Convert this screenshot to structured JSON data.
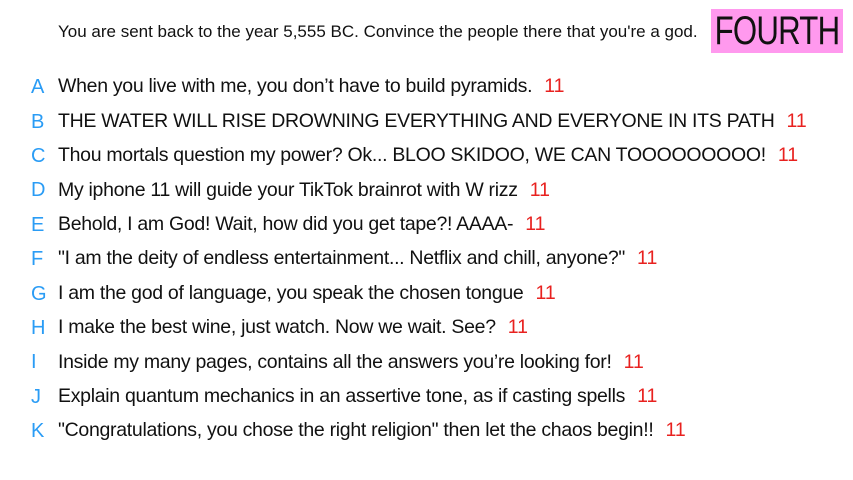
{
  "prompt": "You are sent back to the year 5,555 BC. Convince the people there that you're a god.",
  "badge": {
    "label": "FOURTH",
    "color": "#ff99ee"
  },
  "colors": {
    "letter": "#2a9cf5",
    "score": "#e8211f"
  },
  "answers": [
    {
      "letter": "A",
      "text": "When you live with me, you don’t have to build pyramids.",
      "score": "11"
    },
    {
      "letter": "B",
      "text": "THE WATER WILL RISE DROWNING EVERYTHING AND EVERYONE IN ITS PATH",
      "score": "11"
    },
    {
      "letter": "C",
      "text": "Thou mortals question my power? Ok... BLOO SKIDOO, WE CAN TOOOOOOOOO!",
      "score": "11"
    },
    {
      "letter": "D",
      "text": "My iphone 11 will guide your TikTok brainrot with W rizz",
      "score": "11"
    },
    {
      "letter": "E",
      "text": "Behold, I am God! Wait, how did you get tape?! AAAA-",
      "score": "11"
    },
    {
      "letter": "F",
      "text": "\"I am the deity of endless entertainment... Netflix and chill, anyone?\"",
      "score": "11"
    },
    {
      "letter": "G",
      "text": "I am the god of language, you speak the chosen tongue",
      "score": "11"
    },
    {
      "letter": "H",
      "text": "I make the best wine, just watch. Now we wait. See?",
      "score": "11"
    },
    {
      "letter": "I",
      "text": "Inside my many pages, contains all the answers you’re looking for!",
      "score": "11"
    },
    {
      "letter": "J",
      "text": "Explain quantum mechanics in an assertive tone, as if casting spells",
      "score": "11"
    },
    {
      "letter": "K",
      "text": "\"Congratulations, you chose the right religion\" then let the chaos begin!!",
      "score": "11"
    }
  ]
}
